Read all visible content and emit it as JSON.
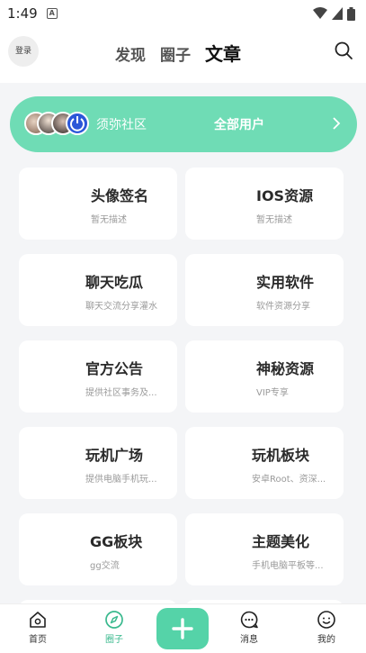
{
  "status_bar": {
    "time": "1:49",
    "notification_glyph": "A",
    "icons": [
      "wifi-icon",
      "signal-icon",
      "battery-icon"
    ]
  },
  "header": {
    "login_label": "登录",
    "tabs": [
      {
        "label": "发现",
        "active": false
      },
      {
        "label": "圈子",
        "active": false
      },
      {
        "label": "文章",
        "active": true
      }
    ],
    "search_icon": "search-icon"
  },
  "banner": {
    "community_name": "须弥社区",
    "all_users_label": "全部用户",
    "avatar_count": 4,
    "background_color": "#6fdcb5"
  },
  "categories": [
    {
      "title": "头像签名",
      "desc": "暂无描述"
    },
    {
      "title": "IOS资源",
      "desc": "暂无描述"
    },
    {
      "title": "聊天吃瓜",
      "desc": "聊天交流分享灌水"
    },
    {
      "title": "实用软件",
      "desc": "软件资源分享"
    },
    {
      "title": "官方公告",
      "desc": "提供社区事务及..."
    },
    {
      "title": "神秘资源",
      "desc": "VIP专享"
    },
    {
      "title": "玩机广场",
      "desc": "提供电脑手机玩..."
    },
    {
      "title": "玩机板块",
      "desc": "安卓Root、资深..."
    },
    {
      "title": "GG板块",
      "desc": "gg交流"
    },
    {
      "title": "主题美化",
      "desc": "手机电脑平板等..."
    }
  ],
  "bottom_nav": {
    "items": [
      {
        "label": "首页",
        "icon": "home-icon",
        "active": false
      },
      {
        "label": "圈子",
        "icon": "compass-icon",
        "active": true
      },
      {
        "label": "",
        "icon": "plus-icon",
        "active": false
      },
      {
        "label": "消息",
        "icon": "message-icon",
        "active": false
      },
      {
        "label": "我的",
        "icon": "profile-icon",
        "active": false
      }
    ],
    "accent_color": "#3ab98e",
    "fab_color": "#55d3a8"
  }
}
